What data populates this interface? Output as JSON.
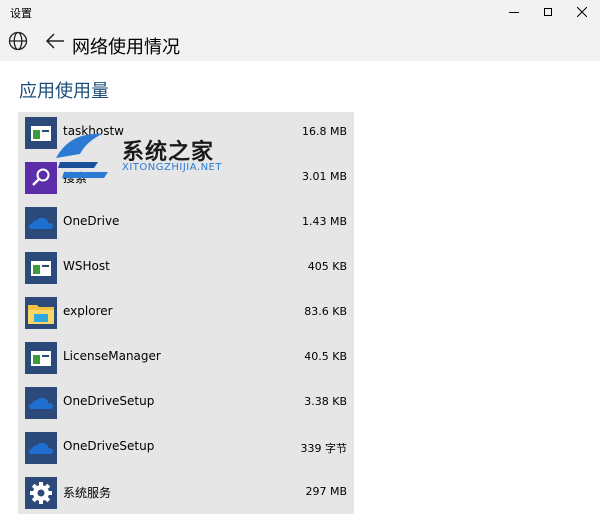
{
  "window": {
    "title": "设置",
    "controls": {
      "minimize": "minimize",
      "maximize": "maximize",
      "close": "✕"
    }
  },
  "header": {
    "page_title": "网络使用情况",
    "icons": {
      "home": "globe-icon",
      "back": "back-arrow-icon"
    }
  },
  "section": {
    "title": "应用使用量"
  },
  "apps": [
    {
      "name": "taskhostw",
      "size": "16.8 MB",
      "icon": "window-app-icon",
      "tile_color": "#2b4a7a"
    },
    {
      "name": "搜索",
      "size": "3.01 MB",
      "icon": "search-icon",
      "tile_color": "#5b2da8"
    },
    {
      "name": "OneDrive",
      "size": "1.43 MB",
      "icon": "onedrive-cloud-icon",
      "tile_color": "#2b4a7a"
    },
    {
      "name": "WSHost",
      "size": "405 KB",
      "icon": "window-app-icon",
      "tile_color": "#2b4a7a"
    },
    {
      "name": "explorer",
      "size": "83.6 KB",
      "icon": "folder-icon",
      "tile_color": "#f0c040"
    },
    {
      "name": "LicenseManager",
      "size": "40.5 KB",
      "icon": "window-app-icon",
      "tile_color": "#2b4a7a"
    },
    {
      "name": "OneDriveSetup",
      "size": "3.38 KB",
      "icon": "onedrive-cloud-icon",
      "tile_color": "#2b4a7a"
    },
    {
      "name": "OneDriveSetup",
      "size": "339 字节",
      "icon": "onedrive-cloud-icon",
      "tile_color": "#2b4a7a"
    },
    {
      "name": "系统服务",
      "size": "297 MB",
      "icon": "gear-icon",
      "tile_color": "#2b4a7a"
    }
  ],
  "watermark": {
    "text": "系统之家",
    "sub": "XITONGZHIJIA.NET"
  }
}
